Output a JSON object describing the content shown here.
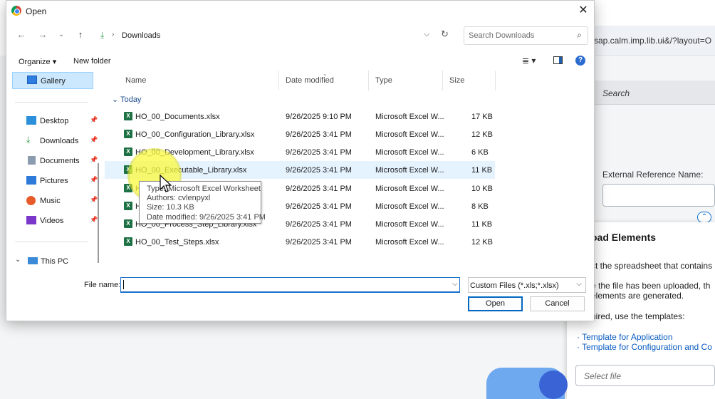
{
  "background": {
    "url_fragment": "sap.calm.imp.lib.ui&/?layout=O",
    "search_label": "Search",
    "external_reference_label": "External Reference Name:",
    "panel_title": "oad Elements",
    "lines": [
      "ct the spreadsheet that contains",
      "e the file has been uploaded, th",
      "elements are generated.",
      "uired, use the templates:"
    ],
    "links": [
      "· Template for Application",
      "· Template for Configuration and Co"
    ],
    "select_file": "Select file"
  },
  "dialog": {
    "title": "Open",
    "close_glyph": "✕",
    "address": {
      "folder": "Downloads"
    },
    "search_placeholder": "Search Downloads",
    "toolbar": {
      "organize": "Organize ▾",
      "new_folder": "New folder"
    },
    "sidebar": {
      "items": [
        {
          "label": "Gallery",
          "icon": "gallery-icon"
        },
        {
          "label": "Desktop",
          "icon": "desktop-icon"
        },
        {
          "label": "Downloads",
          "icon": "downloads-icon"
        },
        {
          "label": "Documents",
          "icon": "documents-icon"
        },
        {
          "label": "Pictures",
          "icon": "pictures-icon"
        },
        {
          "label": "Music",
          "icon": "music-icon"
        },
        {
          "label": "Videos",
          "icon": "videos-icon"
        },
        {
          "label": "This PC",
          "icon": "this-pc-icon"
        }
      ]
    },
    "columns": [
      "Name",
      "Date modified",
      "Type",
      "Size"
    ],
    "group": "Today",
    "files": [
      {
        "name": "HO_00_Documents.xlsx",
        "date": "9/26/2025 9:10 PM",
        "type": "Microsoft Excel W...",
        "size": "17 KB"
      },
      {
        "name": "HO_00_Configuration_Library.xlsx",
        "date": "9/26/2025 3:41 PM",
        "type": "Microsoft Excel W...",
        "size": "12 KB"
      },
      {
        "name": "HO_00_Development_Library.xlsx",
        "date": "9/26/2025 3:41 PM",
        "type": "Microsoft Excel W...",
        "size": "6 KB"
      },
      {
        "name": "HO_00_Executable_Library.xlsx",
        "date": "9/26/2025 3:41 PM",
        "type": "Microsoft Excel W...",
        "size": "11 KB"
      },
      {
        "name": "HC",
        "date": "9/26/2025 3:41 PM",
        "type": "Microsoft Excel W...",
        "size": "10 KB"
      },
      {
        "name": "HC",
        "date": "9/26/2025 3:41 PM",
        "type": "Microsoft Excel W...",
        "size": "8 KB"
      },
      {
        "name": "HO_00_Process_Step_Library.xlsx",
        "date": "9/26/2025 3:41 PM",
        "type": "Microsoft Excel W...",
        "size": "11 KB"
      },
      {
        "name": "HO_00_Test_Steps.xlsx",
        "date": "9/26/2025 3:41 PM",
        "type": "Microsoft Excel W...",
        "size": "12 KB"
      }
    ],
    "tooltip": {
      "type": "Type: Microsoft Excel Worksheet",
      "authors": "Authors: cvlenpyxl",
      "size": "Size: 10.3 KB",
      "date": "Date modified: 9/26/2025 3:41 PM"
    },
    "filename_label": "File name:",
    "filename_value": "",
    "filter": "Custom Files (*.xls;*.xlsx)",
    "open_label": "Open",
    "cancel_label": "Cancel"
  }
}
